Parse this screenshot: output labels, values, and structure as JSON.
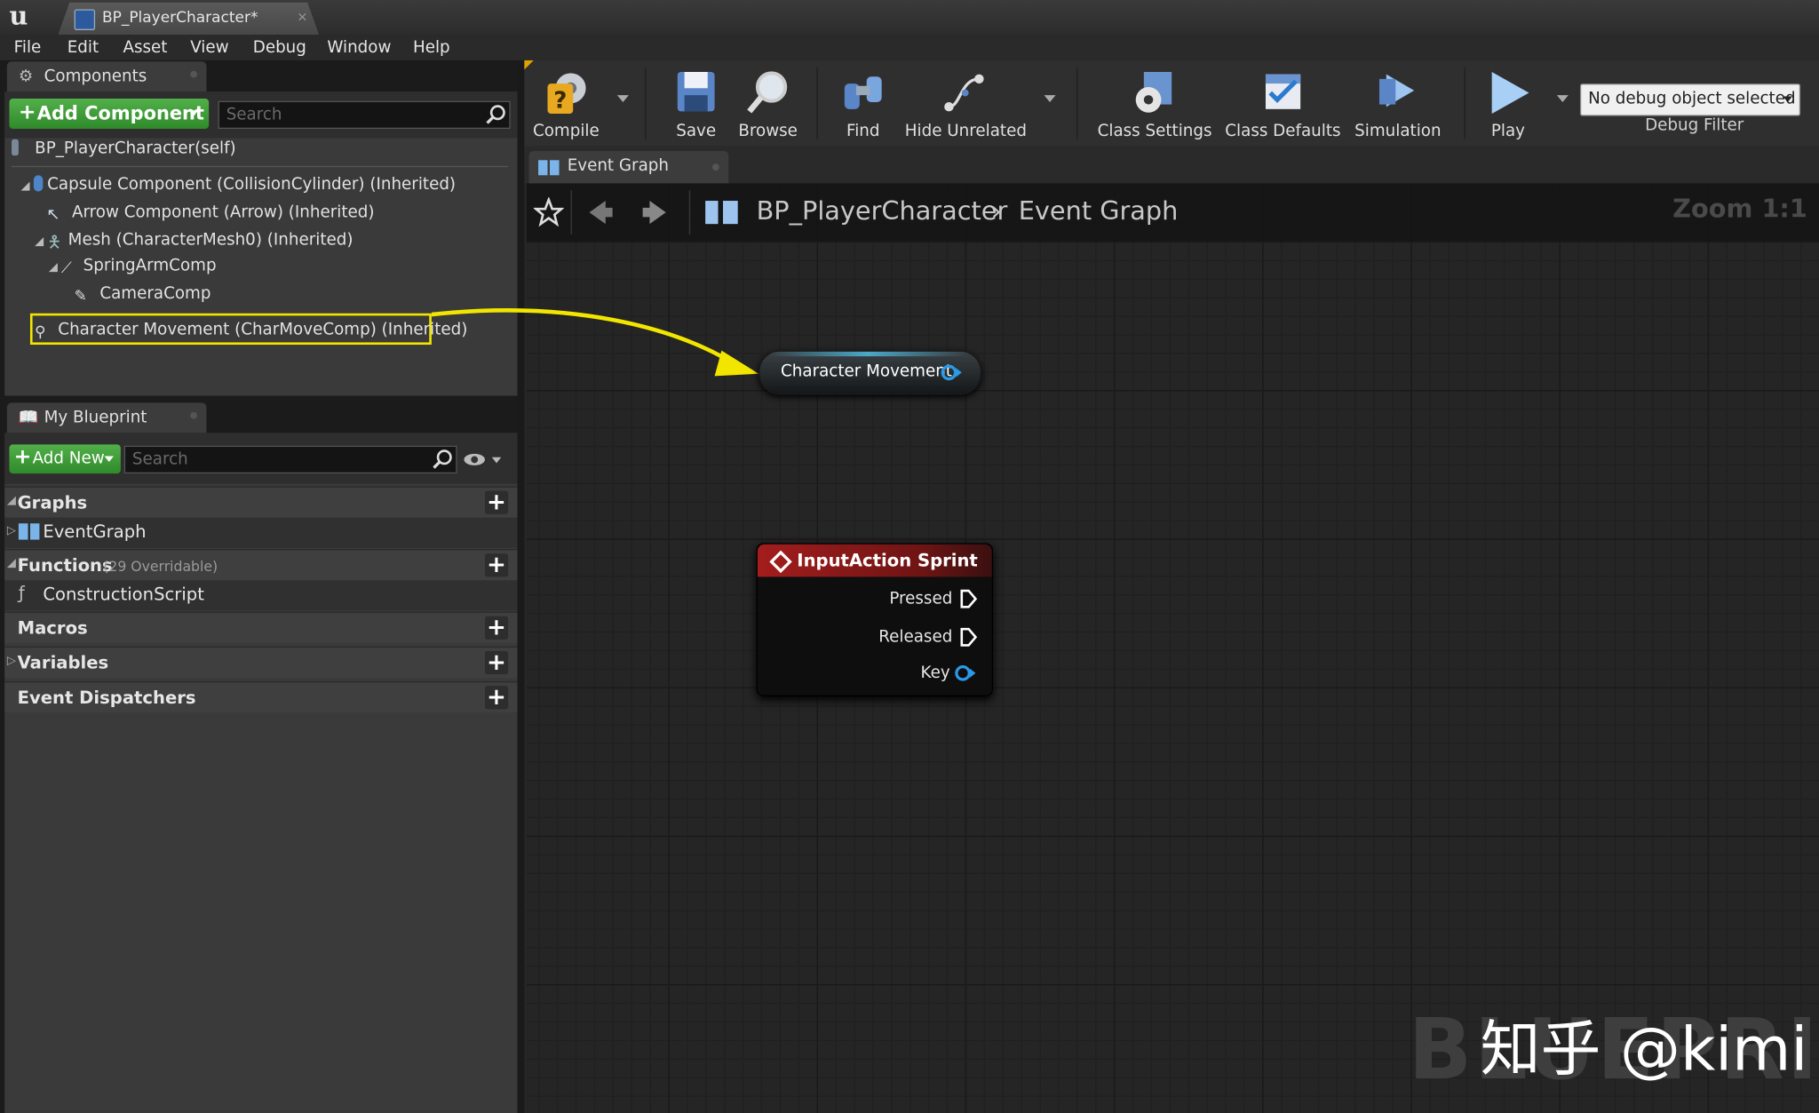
{
  "window": {
    "doc_tab_title": "BP_PlayerCharacter*",
    "close_glyph": "×"
  },
  "menu": [
    "File",
    "Edit",
    "Asset",
    "View",
    "Debug",
    "Window",
    "Help"
  ],
  "components_panel": {
    "tab_label": "Components",
    "add_button": "Add Component",
    "search_placeholder": "Search",
    "self_item": "BP_PlayerCharacter(self)",
    "items": [
      "Capsule Component (CollisionCylinder) (Inherited)",
      "Arrow Component (Arrow) (Inherited)",
      "Mesh (CharacterMesh0) (Inherited)",
      "SpringArmComp",
      "CameraComp",
      "Character Movement (CharMoveComp) (Inherited)"
    ]
  },
  "my_blueprint": {
    "tab_label": "My Blueprint",
    "add_button": "Add New",
    "search_placeholder": "Search",
    "sections": {
      "graphs": "Graphs",
      "event_graph": "EventGraph",
      "functions": "Functions",
      "functions_count": "(29 Overridable)",
      "construction_script": "ConstructionScript",
      "macros": "Macros",
      "variables": "Variables",
      "event_dispatchers": "Event Dispatchers"
    }
  },
  "toolbar": {
    "compile": "Compile",
    "save": "Save",
    "browse": "Browse",
    "find": "Find",
    "hide_unrelated": "Hide Unrelated",
    "class_settings": "Class Settings",
    "class_defaults": "Class Defaults",
    "simulation": "Simulation",
    "play": "Play",
    "debug_select": "No debug object selected",
    "debug_filter": "Debug Filter"
  },
  "graph": {
    "tab_label": "Event Graph",
    "breadcrumb_root": "BP_PlayerCharacter",
    "breadcrumb_leaf": "Event Graph",
    "zoom": "Zoom 1:1",
    "nodes": {
      "char_movement": "Character Movement",
      "input_action": {
        "title": "InputAction Sprint",
        "pins": [
          "Pressed",
          "Released",
          "Key"
        ]
      }
    }
  },
  "watermark": {
    "background_text": "BLUEPRINT",
    "foreground_text": "知乎 @kimi"
  },
  "colors": {
    "accent_green": "#3fa23a",
    "highlight_yellow": "#f2e600",
    "input_node_red": "#8c1a1a",
    "pin_blue": "#2a9ae8"
  }
}
